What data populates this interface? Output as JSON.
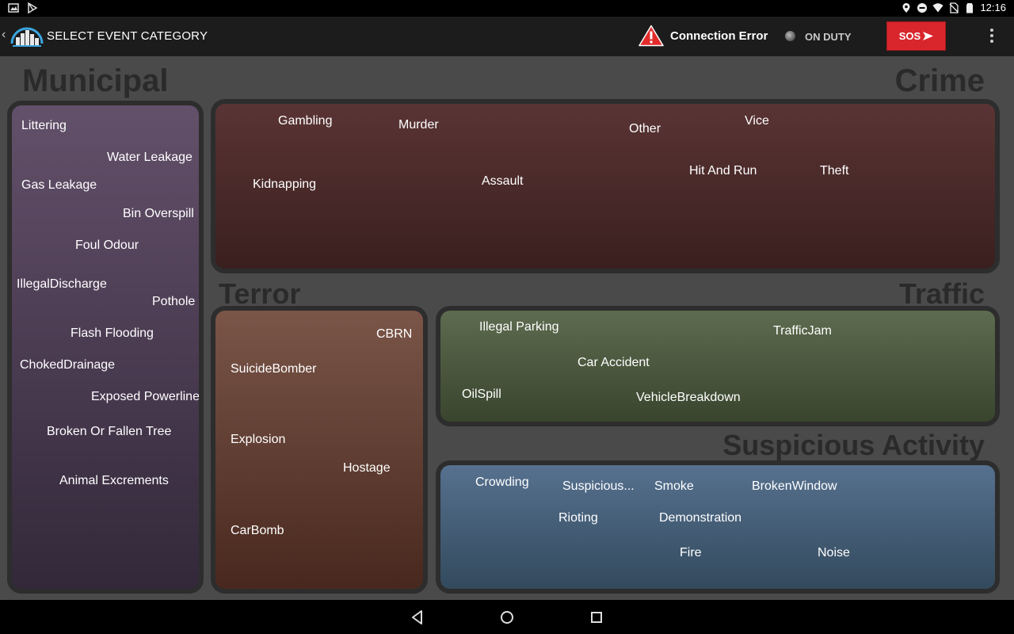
{
  "status_bar": {
    "time": "12:16"
  },
  "app_bar": {
    "title": "SELECT EVENT CATEGORY",
    "connection_status": "Connection Error",
    "duty_status": "ON DUTY",
    "sos_label": "SOS"
  },
  "categories": {
    "municipal": {
      "title": "Municipal",
      "items": [
        "Littering",
        "Water Leakage",
        "Gas Leakage",
        "Bin Overspill",
        "Foul Odour",
        "IllegalDischarge",
        "Pothole",
        "Flash Flooding",
        "ChokedDrainage",
        "Exposed Powerline",
        "Broken Or Fallen Tree",
        "Animal Excrements"
      ]
    },
    "crime": {
      "title": "Crime",
      "items": [
        "Gambling",
        "Murder",
        "Other",
        "Vice",
        "Kidnapping",
        "Assault",
        "Hit And Run",
        "Theft"
      ]
    },
    "terror": {
      "title": "Terror",
      "items": [
        "CBRN",
        "SuicideBomber",
        "Explosion",
        "Hostage",
        "CarBomb"
      ]
    },
    "traffic": {
      "title": "Traffic",
      "items": [
        "Illegal Parking",
        "TrafficJam",
        "Car Accident",
        "OilSpill",
        "VehicleBreakdown"
      ]
    },
    "suspicious": {
      "title": "Suspicious Activity",
      "items": [
        "Crowding",
        "Suspicious...",
        "Smoke",
        "BrokenWindow",
        "Rioting",
        "Demonstration",
        "Fire",
        "Noise"
      ]
    }
  },
  "colors": {
    "sos": "#d8262c",
    "municipal": "#5a4762",
    "crime": "#4e2a2a",
    "terror": "#6a4336",
    "traffic": "#4f5d41",
    "suspicious": "#4a6580"
  }
}
